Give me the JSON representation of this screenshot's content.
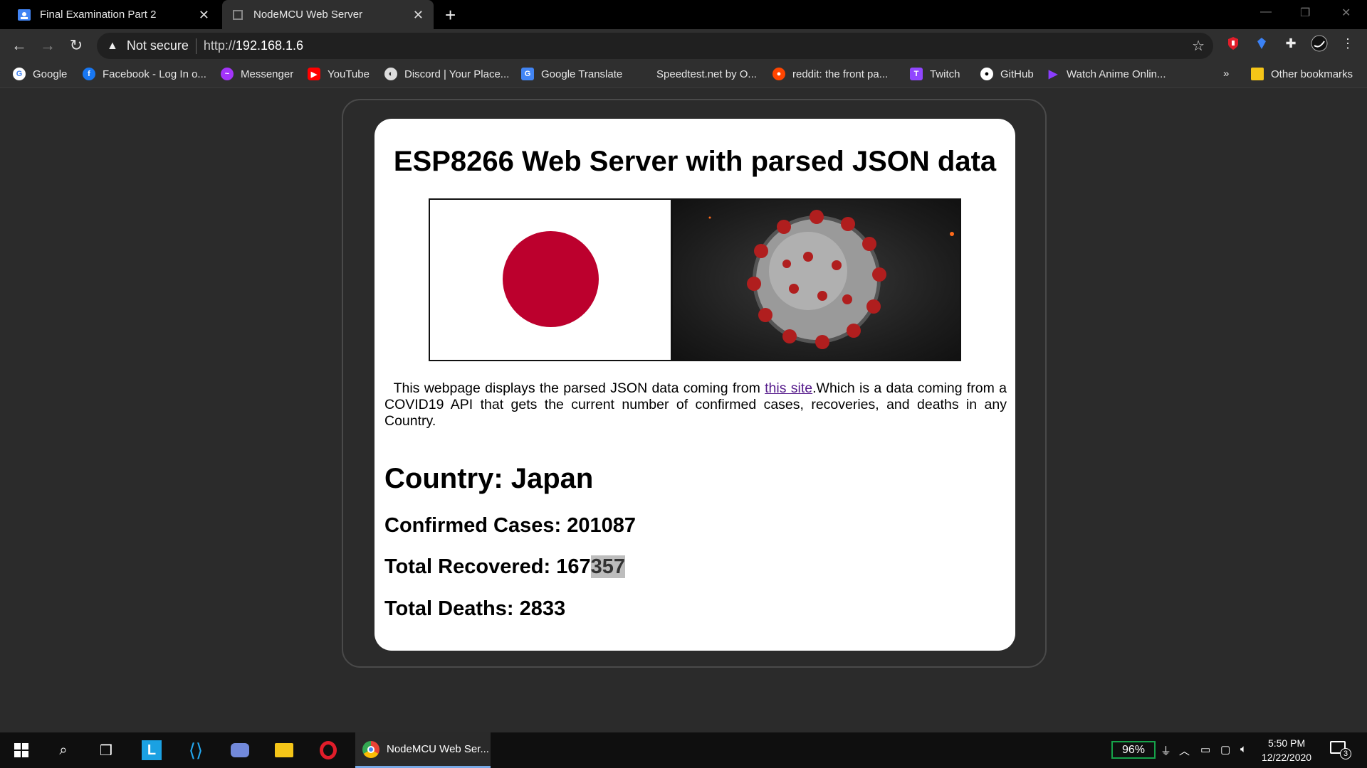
{
  "tabs": [
    {
      "title": "Final Examination Part 2"
    },
    {
      "title": "NodeMCU Web Server"
    }
  ],
  "omnibox": {
    "security_label": "Not secure",
    "url_prefix": "http://",
    "url_host": "192.168.1.6"
  },
  "bookmarks": [
    {
      "label": "Google",
      "icon": "google-icon",
      "color": "#4285f4"
    },
    {
      "label": "Facebook - Log In o...",
      "icon": "facebook-icon",
      "color": "#1877f2"
    },
    {
      "label": "Messenger",
      "icon": "messenger-icon",
      "color": "#a334fa"
    },
    {
      "label": "YouTube",
      "icon": "youtube-icon",
      "color": "#ff0000"
    },
    {
      "label": "Discord | Your Place...",
      "icon": "discord-icon",
      "color": "#cccccc"
    },
    {
      "label": "Google Translate",
      "icon": "translate-icon",
      "color": "#4285f4"
    },
    {
      "label": "Speedtest.net by O...",
      "icon": "speedtest-icon",
      "color": "#2f2f2f"
    },
    {
      "label": "reddit: the front pa...",
      "icon": "reddit-icon",
      "color": "#ff4500"
    },
    {
      "label": "Twitch",
      "icon": "twitch-icon",
      "color": "#9146ff"
    },
    {
      "label": "GitHub",
      "icon": "github-icon",
      "color": "#ffffff"
    },
    {
      "label": "Watch Anime Onlin...",
      "icon": "anime-icon",
      "color": "#8b3dff"
    }
  ],
  "bookmarks_overflow": "»",
  "other_bookmarks": "Other bookmarks",
  "page": {
    "heading": "ESP8266 Web Server with parsed JSON data",
    "desc_before": "This webpage displays the parsed JSON data coming from ",
    "desc_link": "this site",
    "desc_after": ".Which is a data coming from a COVID19 API that gets the current number of confirmed cases, recoveries, and deaths in any Country.",
    "country": "Country: Japan",
    "confirmed": "Confirmed Cases: 201087",
    "recovered_prefix": "Total Recovered: 167",
    "recovered_selected": "357",
    "deaths": "Total Deaths: 2833"
  },
  "taskbar": {
    "active_app": "NodeMCU Web Ser...",
    "battery": "96%",
    "time": "5:50 PM",
    "date": "12/22/2020",
    "notification_count": "3"
  },
  "colors": {
    "flag_red": "#bc002d",
    "link": "#551a8b",
    "battery_border": "#16a34a"
  }
}
